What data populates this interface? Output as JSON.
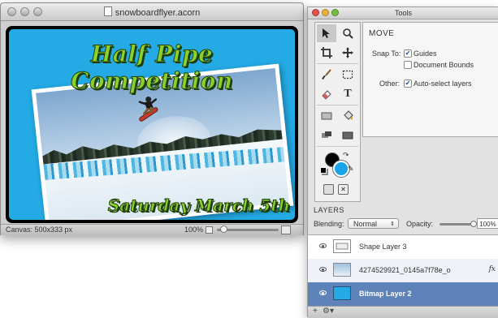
{
  "document": {
    "title": "snowboardflyer.acorn",
    "poster": {
      "headline": "Half Pipe Competition",
      "date_line": "Saturday March 5th",
      "background_color": "#24abe6",
      "text_color": "#8bd12e"
    },
    "status": {
      "canvas_info": "Canvas: 500x333 px",
      "zoom": "100%",
      "zoom_level_fraction": 0.1
    }
  },
  "tools": {
    "title": "Tools",
    "palette": {
      "items": [
        "move-tool",
        "zoom-tool",
        "crop-tool",
        "pan-tool",
        "brush-tool",
        "marquee-tool",
        "eraser-tool",
        "text-tool",
        "rect-shape-tool",
        "fill-tool",
        "gradient-tool",
        "layer-tool"
      ],
      "foreground_color": "#000000",
      "background_color": "#1aa5e8"
    },
    "move_panel": {
      "title": "MOVE",
      "snap_to_label": "Snap To:",
      "guides_label": "Guides",
      "guides_checked": true,
      "document_bounds_label": "Document Bounds",
      "document_bounds_checked": false,
      "other_label": "Other:",
      "auto_select_label": "Auto-select layers",
      "auto_select_checked": true
    }
  },
  "layers": {
    "header": "LAYERS",
    "blending_label": "Blending:",
    "blending_value": "Normal",
    "opacity_label": "Opacity:",
    "opacity_value": "100%",
    "items": [
      {
        "name": "Shape Layer 3",
        "fx": ""
      },
      {
        "name": "4274529921_0145a7f78e_o",
        "fx": "fx"
      },
      {
        "name": "Bitmap Layer 2",
        "fx": ""
      }
    ],
    "footer_add": "+",
    "footer_gear": "⚙▾"
  }
}
